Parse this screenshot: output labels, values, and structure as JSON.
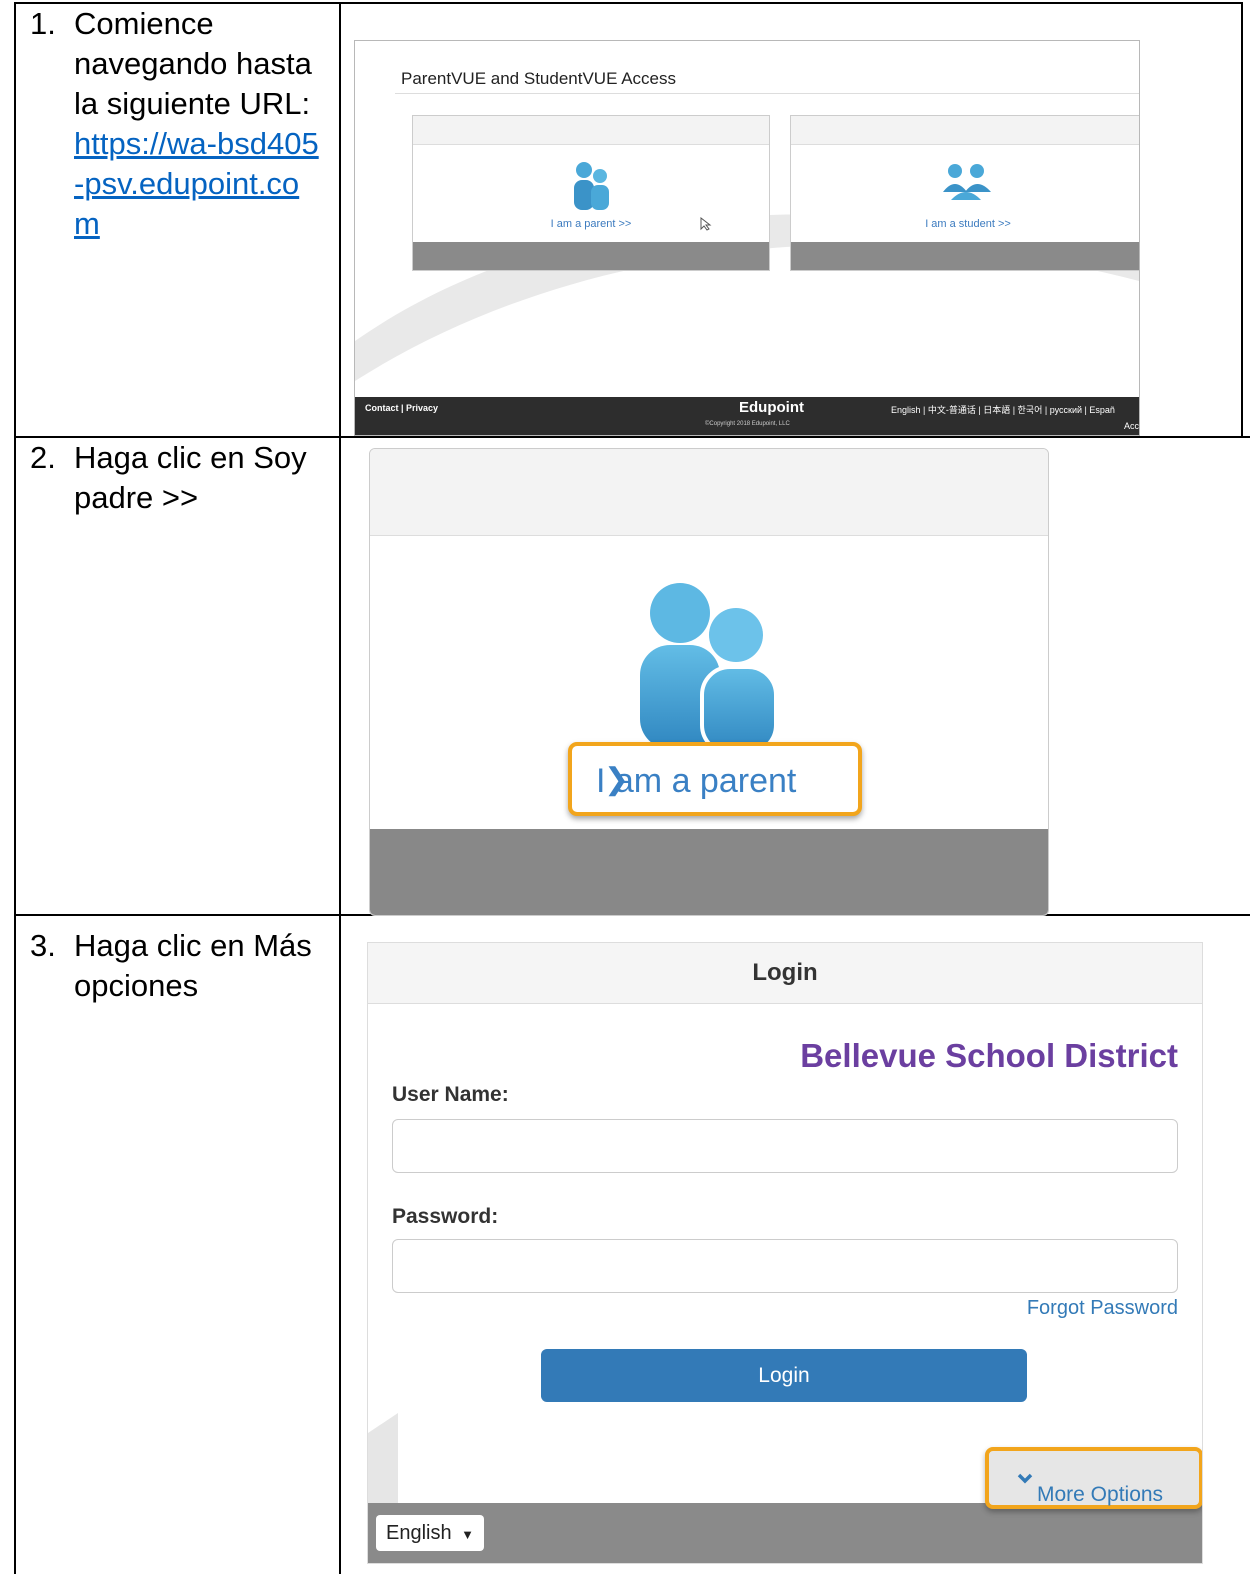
{
  "steps": [
    {
      "number": "1.",
      "text": "Comience navegando hasta la siguiente URL:",
      "link": "https://wa-bsd405-psv.edupoint.com"
    },
    {
      "number": "2.",
      "text": "Haga clic en Soy padre >>"
    },
    {
      "number": "3.",
      "text": "Haga clic en Más opciones"
    }
  ],
  "shot1": {
    "title": "ParentVUE and StudentVUE Access",
    "parent_label": "I am a parent >>",
    "student_label": "I am a student >>",
    "footer_left": "Contact | Privacy",
    "brand": "Edupoint",
    "copyright": "©Copyright 2018 Edupoint, LLC",
    "languages": "English | 中文-普通话 | 日本語 | 한국어 | русский | Españ",
    "footer_right_cut": "Acc"
  },
  "shot2": {
    "parent_link": "I am a parent",
    "chevron": "❯",
    "highlight_color": "#f2a51c"
  },
  "shot3": {
    "header": "Login",
    "district": "Bellevue School District",
    "username_label": "User Name:",
    "password_label": "Password:",
    "forgot": "Forgot Password",
    "login_button": "Login",
    "more_options": "More Options",
    "language": "English",
    "accent_color": "#337ab7",
    "district_color": "#6b3fa0"
  }
}
